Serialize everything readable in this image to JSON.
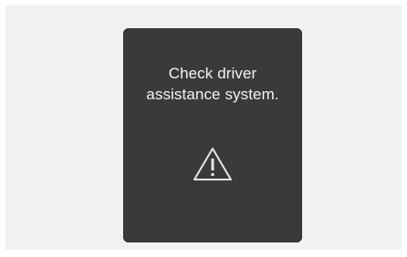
{
  "warning_screen": {
    "message_line1": "Check driver",
    "message_line2": "assistance system.",
    "icon": "warning-triangle-icon"
  },
  "colors": {
    "background": "#f1f1f1",
    "panel": "#3a3a3a",
    "text": "#f4f4f4"
  }
}
